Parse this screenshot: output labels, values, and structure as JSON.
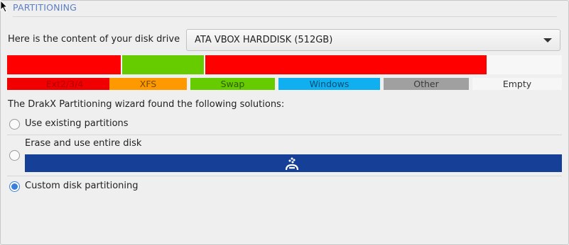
{
  "section": {
    "title": "PARTITIONING"
  },
  "drive": {
    "label": "Here is the content of your disk drive",
    "selected": "ATA VBOX HARDDISK (512GB)"
  },
  "disk_segments": [
    {
      "type": "Ext2/3/4",
      "color": "#ff0000"
    },
    {
      "type": "XFS",
      "color": "#66cc00"
    },
    {
      "type": "Ext2/3/4",
      "color": "#ff0000"
    },
    {
      "type": "Empty",
      "color": "#f7f7f7"
    }
  ],
  "legend": {
    "ext": "Ext2/3/4",
    "xfs": "XFS",
    "swap": "Swap",
    "windows": "Windows",
    "other": "Other",
    "empty": "Empty"
  },
  "wizard_text": "The DrakX Partitioning wizard found the following solutions:",
  "options": {
    "use_existing": {
      "label": "Use existing partitions",
      "checked": false
    },
    "erase_disk": {
      "label": "Erase and use entire disk",
      "checked": false
    },
    "custom": {
      "label": "Custom disk partitioning",
      "checked": true
    }
  },
  "colors": {
    "accent": "#3b7fd9",
    "erase_bar": "#163f98",
    "title": "#5b7fc2"
  }
}
